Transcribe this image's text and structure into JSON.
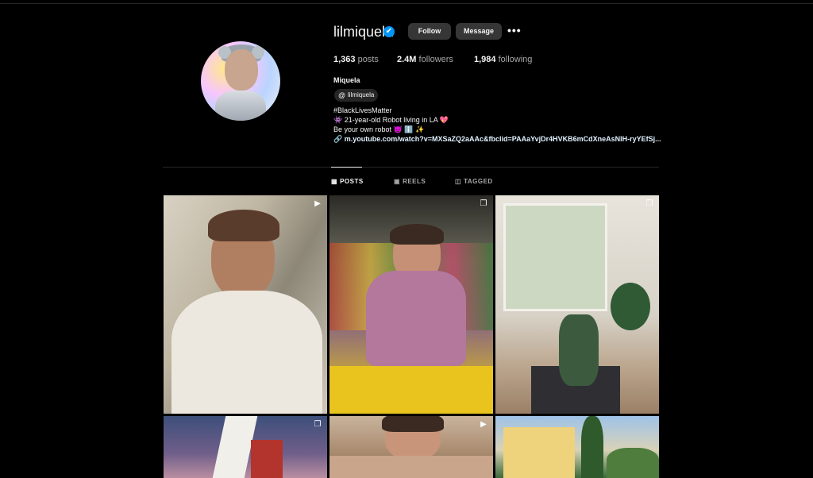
{
  "profile": {
    "username": "lilmiquela",
    "verified_icon": "✔",
    "follow_label": "Follow",
    "message_label": "Message",
    "more_label": "•••",
    "stats": {
      "posts_count": "1,363",
      "posts_label": "posts",
      "followers_count": "2.4M",
      "followers_label": "followers",
      "following_count": "1,984",
      "following_label": "following"
    },
    "full_name": "Miquela",
    "threads_icon": "@",
    "threads_handle": "lilmiquela",
    "bio": {
      "line1": "#BlackLivesMatter",
      "line2": "👾 21-year-old Robot living in LA 💖",
      "line3": "Be your own robot 😈 ℹ️ ✨",
      "link_icon": "🔗",
      "link": "m.youtube.com/watch?v=MXSaZQ2aAAc&fbclid=PAAaYvjDr4HVKB6mCdXneAsNIH-ryYEfSj..."
    }
  },
  "tabs": [
    {
      "icon": "▦",
      "label": "POSTS"
    },
    {
      "icon": "▣",
      "label": "REELS"
    },
    {
      "icon": "◫",
      "label": "TAGGED"
    }
  ],
  "post_badges": {
    "reel_icon": "▶",
    "carousel_icon": "❐"
  },
  "colors": {
    "background": "#000000",
    "button": "#363636",
    "verified": "#0095f6",
    "muted_text": "#a8a8a8"
  }
}
